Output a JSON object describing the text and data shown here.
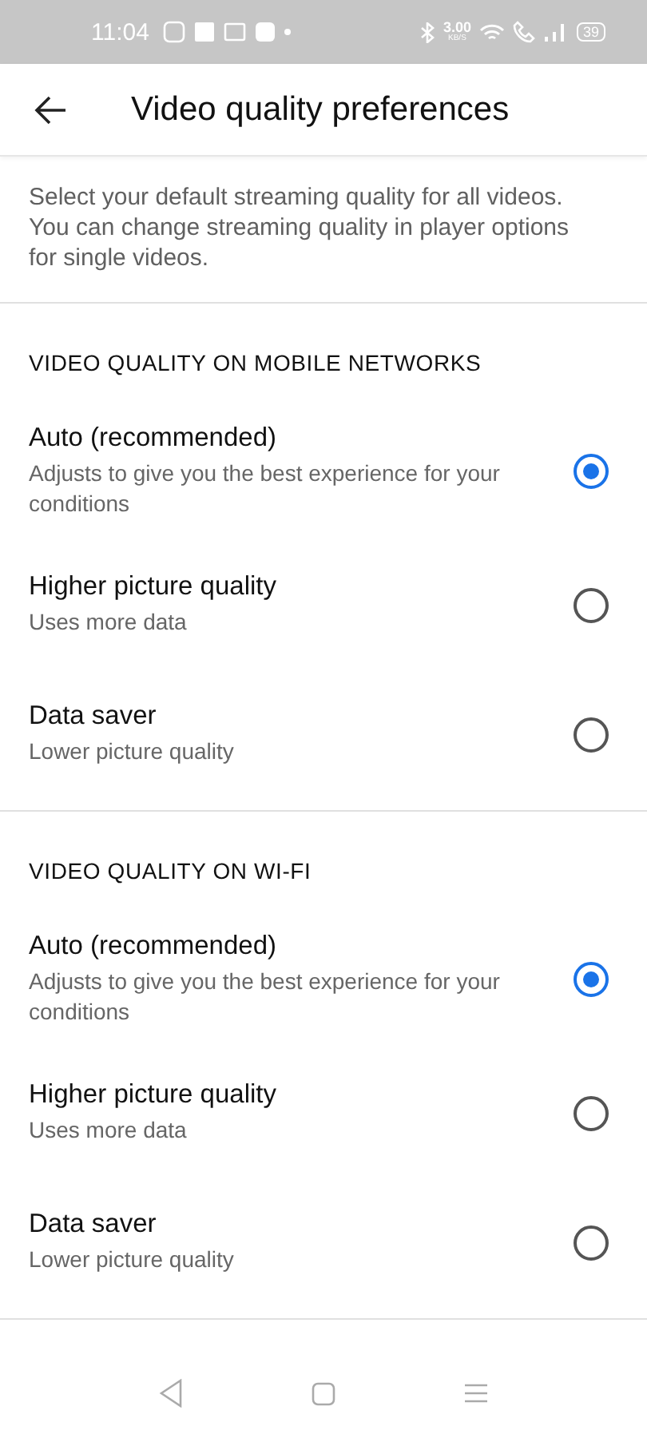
{
  "status_bar": {
    "time": "11:04",
    "speed": "3.00",
    "speed_unit": "KB/S",
    "battery": "39"
  },
  "title": "Video quality preferences",
  "description": "Select your default streaming quality for all videos. You can change streaming quality in player options for single videos.",
  "sections": [
    {
      "heading": "VIDEO QUALITY ON MOBILE NETWORKS",
      "options": [
        {
          "title": "Auto (recommended)",
          "subtitle": "Adjusts to give you the best experience for your conditions",
          "selected": true
        },
        {
          "title": "Higher picture quality",
          "subtitle": "Uses more data",
          "selected": false
        },
        {
          "title": "Data saver",
          "subtitle": "Lower picture quality",
          "selected": false
        }
      ]
    },
    {
      "heading": "VIDEO QUALITY ON WI-FI",
      "options": [
        {
          "title": "Auto (recommended)",
          "subtitle": "Adjusts to give you the best experience for your conditions",
          "selected": true
        },
        {
          "title": "Higher picture quality",
          "subtitle": "Uses more data",
          "selected": false
        },
        {
          "title": "Data saver",
          "subtitle": "Lower picture quality",
          "selected": false
        }
      ]
    }
  ]
}
